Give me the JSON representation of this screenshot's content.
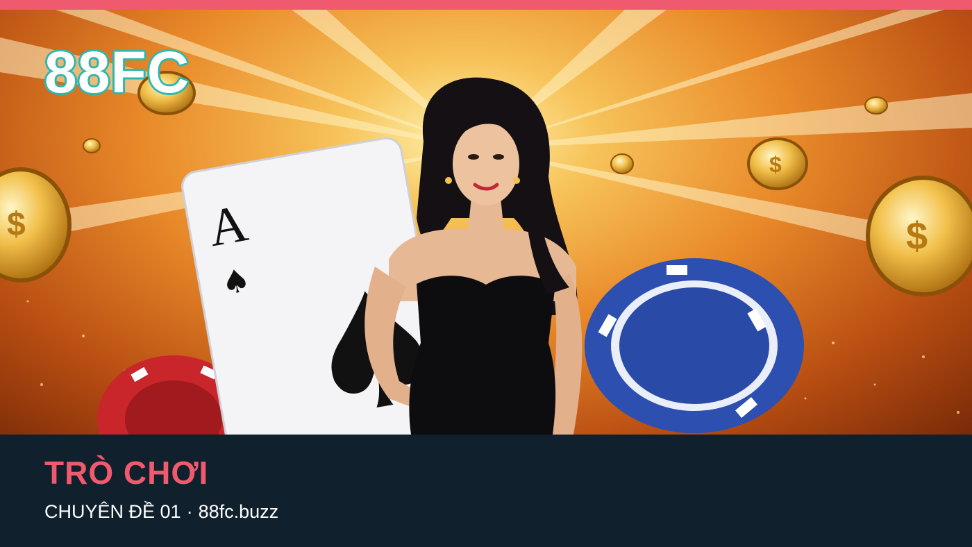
{
  "banner": {
    "logo_text": "88FC",
    "card_rank": "A",
    "card_suit_glyph": "♠",
    "accent_color": "#f05a6e",
    "logo_outline_color": "#2bb8b0"
  },
  "footer": {
    "title": "TRÒ CHƠI",
    "topic": "CHUYÊN ĐỀ 01",
    "separator": "·",
    "domain": "88fc.buzz",
    "background_color": "#10202c"
  }
}
